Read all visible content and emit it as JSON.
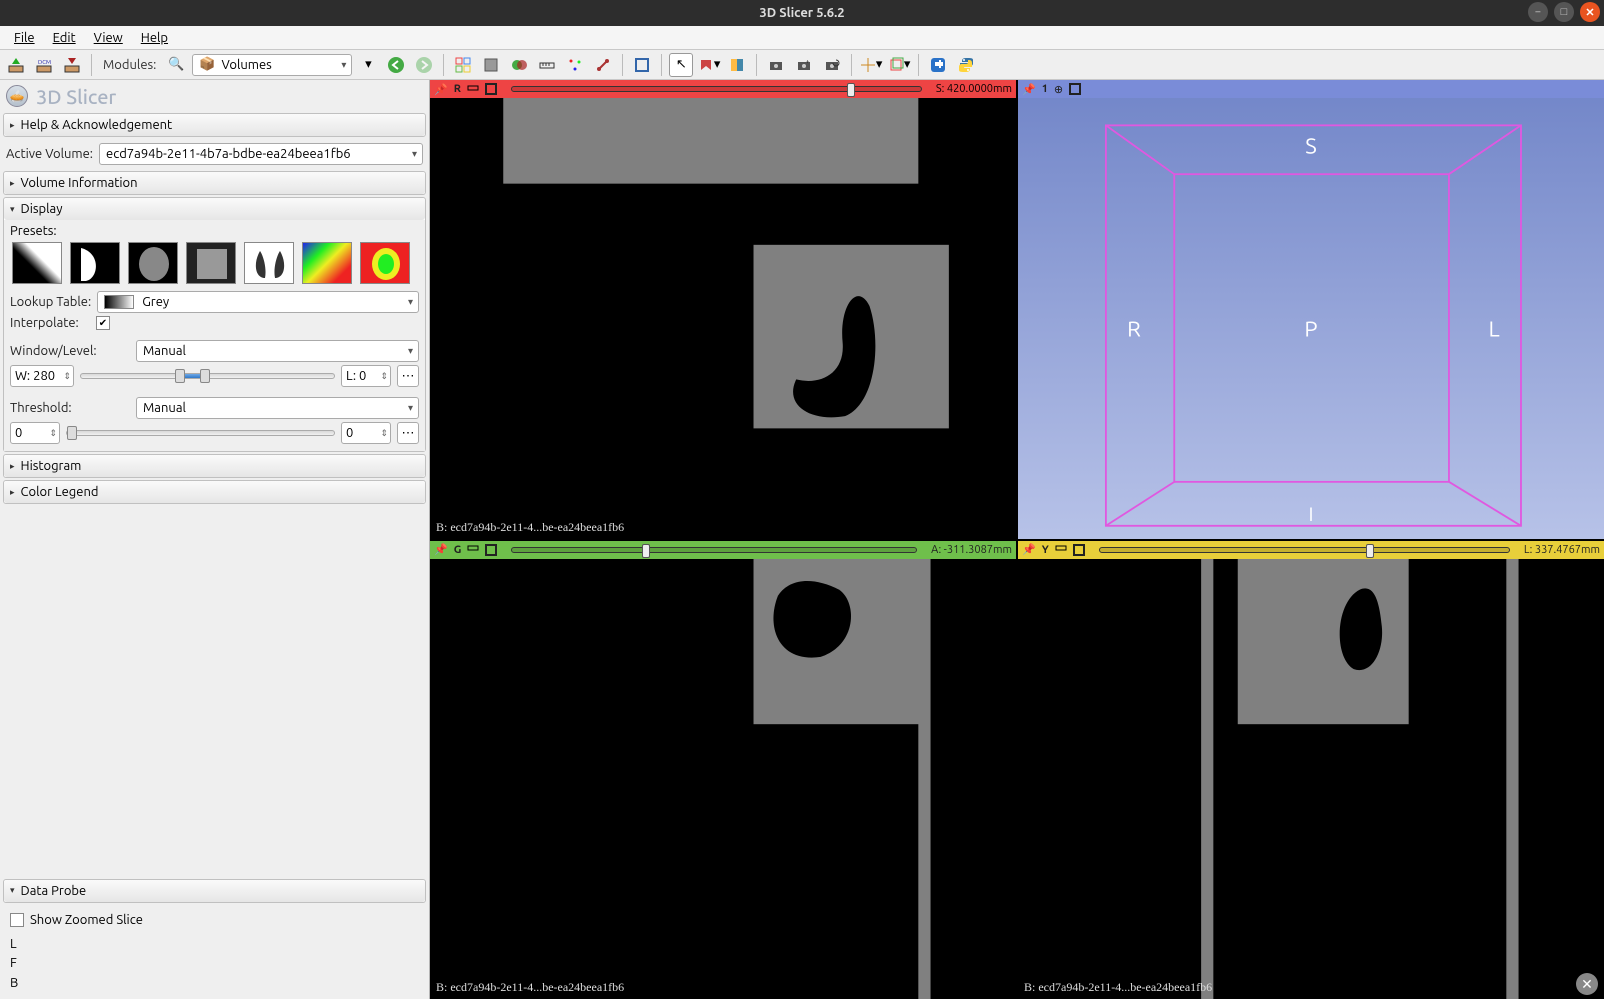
{
  "window": {
    "title": "3D Slicer 5.6.2"
  },
  "menu": {
    "file": "File",
    "edit": "Edit",
    "view": "View",
    "help": "Help"
  },
  "toolbar": {
    "modules_label": "Modules:",
    "module_selected": "Volumes"
  },
  "logo": {
    "text": "3D Slicer"
  },
  "panels": {
    "help": "Help & Acknowledgement",
    "active_volume_label": "Active Volume:",
    "active_volume": "ecd7a94b-2e11-4b7a-bdbe-ea24beea1fb6",
    "volume_info": "Volume Information",
    "display": "Display",
    "presets_label": "Presets:",
    "lookup_label": "Lookup Table:",
    "lookup_value": "Grey",
    "interpolate_label": "Interpolate:",
    "window_level_label": "Window/Level:",
    "window_level_mode": "Manual",
    "w_label": "W: 280",
    "l_label": "L: 0",
    "threshold_label": "Threshold:",
    "threshold_mode": "Manual",
    "thr_low": "0",
    "thr_high": "0",
    "histogram": "Histogram",
    "color_legend": "Color Legend"
  },
  "dataprobe": {
    "title": "Data Probe",
    "show_zoomed": "Show Zoomed Slice",
    "L": "L",
    "F": "F",
    "B": "B"
  },
  "views": {
    "red": {
      "axis": "R",
      "info": "S: 420.0000mm",
      "overlay": "B: ecd7a94b-2e11-4...be-ea24beea1fb6"
    },
    "green": {
      "axis": "G",
      "info": "A: -311.3087mm",
      "overlay": "B: ecd7a94b-2e11-4...be-ea24beea1fb6"
    },
    "yellow": {
      "axis": "Y",
      "info": "L: 337.4767mm",
      "overlay": "B: ecd7a94b-2e11-4...be-ea24beea1fb6"
    },
    "threeD": {
      "label": "1",
      "S": "S",
      "R": "R",
      "L": "L",
      "P": "P",
      "I": "I"
    }
  }
}
